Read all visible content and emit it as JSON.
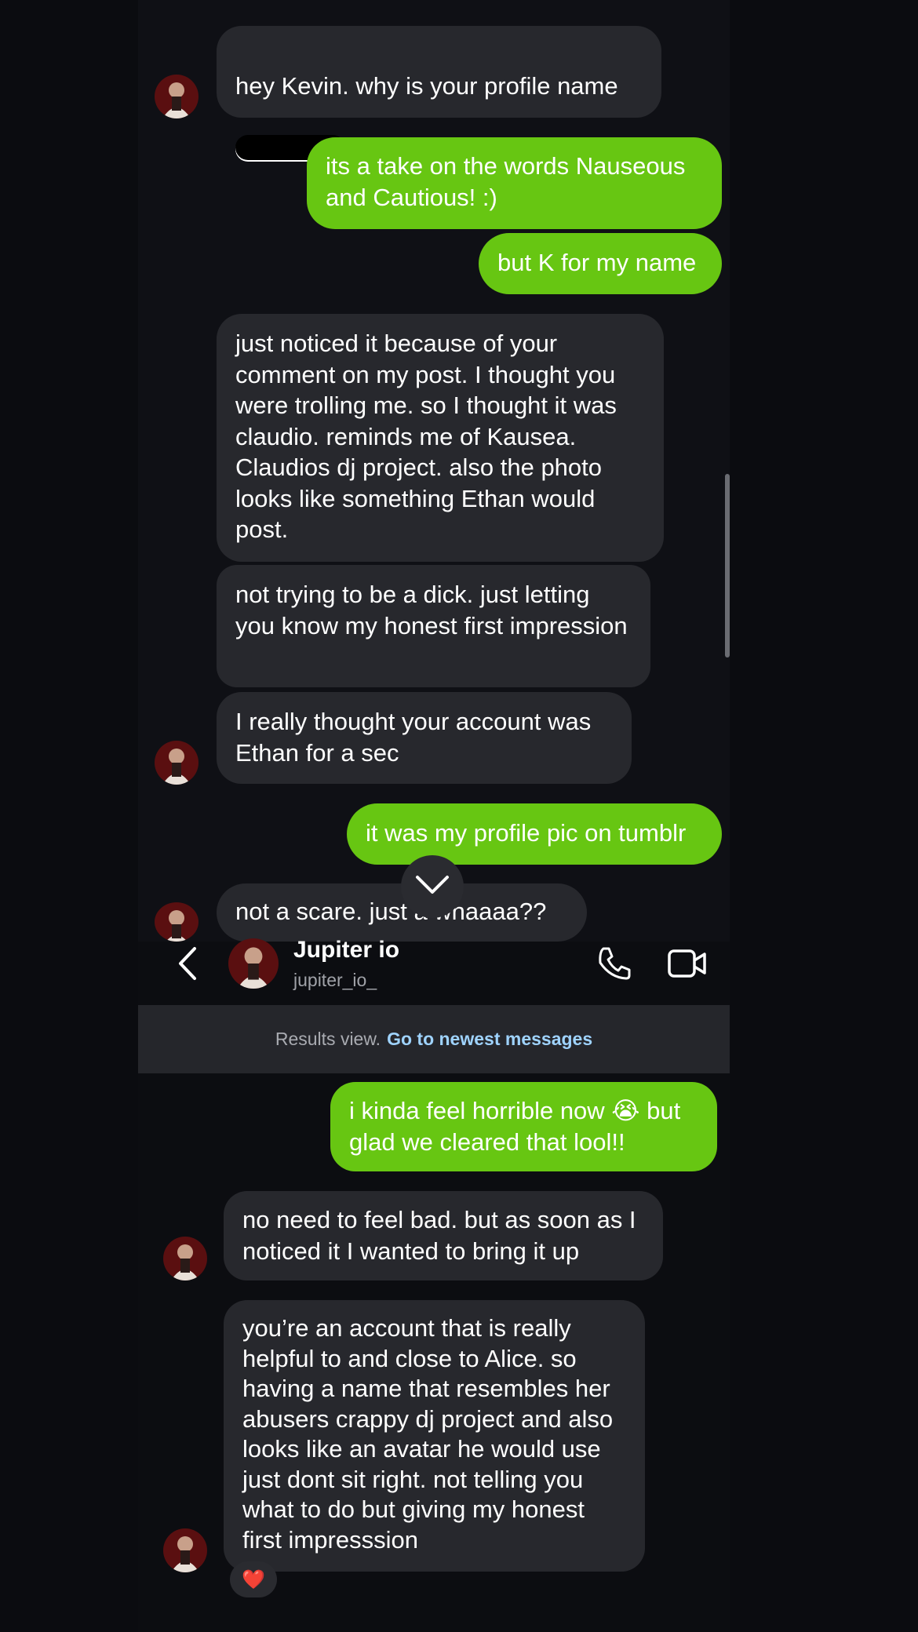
{
  "conversation": {
    "contact_name": "Jupiter io",
    "contact_username": "jupiter_io_"
  },
  "messages_top": [
    {
      "side": "in",
      "text": "hey Kevin.  why is your profile name"
    },
    {
      "side": "out",
      "text": "its a take on the words Nauseous and Cautious! :)"
    },
    {
      "side": "out",
      "text": "but K for my name"
    },
    {
      "side": "in",
      "text": "just noticed it because of your comment on my post.   I thought you were trolling me.   so I thought it was claudio.  reminds me of Kausea.    Claudios dj project.    also the photo looks like something Ethan would post."
    },
    {
      "side": "in",
      "text": "not trying to be a dick.   just letting you know my honest first impression"
    },
    {
      "side": "in",
      "text": "I really thought your account was Ethan for a sec"
    },
    {
      "side": "out",
      "text": "it was my profile pic on tumblr"
    },
    {
      "side": "in",
      "text": "not a scare.    just a whaaaa??"
    }
  ],
  "first_message_suffix": "?",
  "banner": {
    "muted_text": "Results view.",
    "link_text": "Go to newest messages"
  },
  "messages_bottom": [
    {
      "side": "out",
      "text": "i kinda feel horrible now 😭 but glad we cleared that lool!!"
    },
    {
      "side": "in",
      "text": "no need to feel bad. but as soon as I noticed it I wanted to bring it up"
    },
    {
      "side": "in",
      "text": "you’re an account that is really helpful to and close to Alice.   so having a name that resembles her abusers crappy dj project and also looks like an avatar he would use just dont sit right.    not telling you what to do but giving my honest first impresssion"
    }
  ],
  "reaction": "❤️",
  "icons": {
    "back": "chevron-left-icon",
    "call": "phone-icon",
    "video": "video-camera-icon",
    "jump": "chevron-down-icon"
  },
  "colors": {
    "outgoing_bubble": "#67c612",
    "incoming_bubble": "#27282d",
    "link": "#9fd3ff"
  }
}
